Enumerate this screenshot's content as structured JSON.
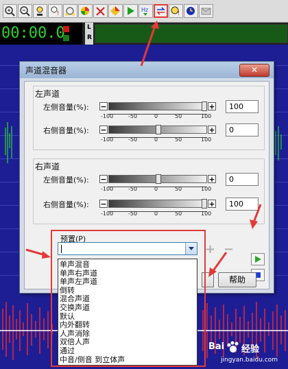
{
  "toolbar": {
    "icons": [
      "zoom-in-icon",
      "zoom-out-icon",
      "mark-icon",
      "mark-clear-icon",
      "level-icon",
      "echo-icon",
      "noise-icon",
      "diamond-icon",
      "play-fx-icon",
      "hz-icon",
      "hz-down-icon",
      "channel-mixer-icon",
      "stats-icon",
      "clock-icon",
      "mail-icon"
    ],
    "hz_label": "Hz"
  },
  "transport": {
    "time": "00:00.0",
    "left_channel": "L",
    "right_channel": "R"
  },
  "dialog": {
    "title": "声道混音器",
    "close": "✕",
    "left_group": {
      "label": "左声道",
      "rows": [
        {
          "label": "左侧音量(%):",
          "value": "100",
          "level": 100
        },
        {
          "label": "右侧音量(%):",
          "value": "0",
          "level": 0
        }
      ]
    },
    "right_group": {
      "label": "右声道",
      "rows": [
        {
          "label": "左侧音量(%):",
          "value": "0",
          "level": 0
        },
        {
          "label": "右侧音量(%):",
          "value": "100",
          "level": 100
        }
      ]
    },
    "ticks": [
      "-100",
      "-50",
      "0",
      "50",
      "100"
    ],
    "minus": "−",
    "plus": "+",
    "preset": {
      "label": "预置(P)",
      "value": ""
    },
    "help": "帮助",
    "play_icon": "play-icon",
    "stop_icon": "stop-icon",
    "add_preset": "+",
    "remove_preset": "−"
  },
  "dropdown_items": [
    "单声混音",
    "单声右声道",
    "单声左声道",
    "倒转",
    "混合声道",
    "交换声道",
    "默认",
    "内外翻转",
    "人声消除",
    "双倍人声",
    "通过",
    "中音/侧音 到立体声"
  ],
  "watermark": {
    "brand": "Bai",
    "brand2": "经验",
    "url": "jingyan.baidu.com"
  },
  "colors": {
    "highlight": "#e23a3a",
    "play": "#2aa52a",
    "stop": "#1a3fd6",
    "wave_bg": "#1e1e94"
  }
}
